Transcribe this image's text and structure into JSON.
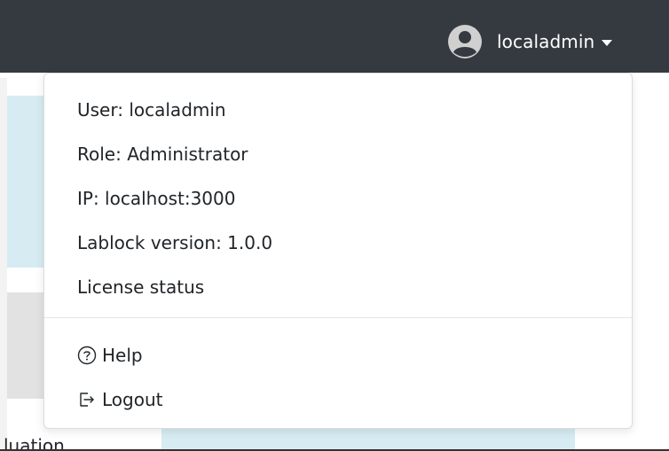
{
  "header": {
    "username": "localadmin",
    "avatar_icon": "user-circle-icon",
    "caret_icon": "caret-down-icon"
  },
  "user_menu": {
    "info": {
      "user": "User: localadmin",
      "role": "Role: Administrator",
      "ip": "IP: localhost:3000",
      "version": "Lablock version: 1.0.0"
    },
    "license_status": "License status",
    "help": {
      "label": "Help",
      "icon": "question-circle-icon"
    },
    "logout": {
      "label": "Logout",
      "icon": "logout-icon"
    }
  },
  "background": {
    "partial_text": "luation"
  },
  "colors": {
    "topbar": "#343a40",
    "panel_cyan": "#d6ecf2",
    "panel_gray": "#e2e2e2",
    "text": "#212529"
  }
}
